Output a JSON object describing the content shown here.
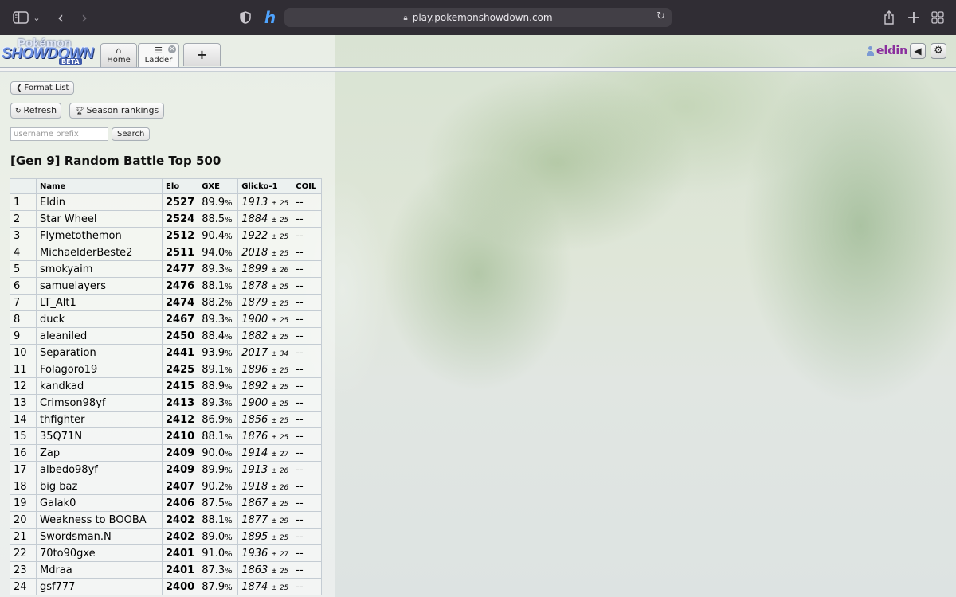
{
  "browser": {
    "url": "play.pokemonshowdown.com"
  },
  "logo": {
    "top": "Pokémon",
    "main": "SHOWDOWN",
    "sub": "BETA"
  },
  "nav": {
    "home_label": "Home",
    "ladder_label": "Ladder",
    "new_tab_label": "+"
  },
  "user": {
    "name": "eldin"
  },
  "page": {
    "format_list_label": "Format List",
    "refresh_label": "Refresh",
    "season_rankings_label": "Season rankings",
    "search_placeholder": "username prefix",
    "search_label": "Search",
    "title": "[Gen 9] Random Battle Top 500"
  },
  "table": {
    "headers": [
      "",
      "Name",
      "Elo",
      "GXE",
      "Glicko-1",
      "COIL"
    ],
    "rows": [
      {
        "rank": "1",
        "name": "Eldin",
        "elo": "2527",
        "gxe": "89.9",
        "glicko": "1913",
        "dev": "± 25",
        "coil": "--"
      },
      {
        "rank": "2",
        "name": "Star Wheel",
        "elo": "2524",
        "gxe": "88.5",
        "glicko": "1884",
        "dev": "± 25",
        "coil": "--"
      },
      {
        "rank": "3",
        "name": "Flymetothemon",
        "elo": "2512",
        "gxe": "90.4",
        "glicko": "1922",
        "dev": "± 25",
        "coil": "--"
      },
      {
        "rank": "4",
        "name": "MichaelderBeste2",
        "elo": "2511",
        "gxe": "94.0",
        "glicko": "2018",
        "dev": "± 25",
        "coil": "--"
      },
      {
        "rank": "5",
        "name": "smokyaim",
        "elo": "2477",
        "gxe": "89.3",
        "glicko": "1899",
        "dev": "± 26",
        "coil": "--"
      },
      {
        "rank": "6",
        "name": "samuelayers",
        "elo": "2476",
        "gxe": "88.1",
        "glicko": "1878",
        "dev": "± 25",
        "coil": "--"
      },
      {
        "rank": "7",
        "name": "LT_Alt1",
        "elo": "2474",
        "gxe": "88.2",
        "glicko": "1879",
        "dev": "± 25",
        "coil": "--"
      },
      {
        "rank": "8",
        "name": "duck",
        "elo": "2467",
        "gxe": "89.3",
        "glicko": "1900",
        "dev": "± 25",
        "coil": "--"
      },
      {
        "rank": "9",
        "name": "aleaniled",
        "elo": "2450",
        "gxe": "88.4",
        "glicko": "1882",
        "dev": "± 25",
        "coil": "--"
      },
      {
        "rank": "10",
        "name": "Separation",
        "elo": "2441",
        "gxe": "93.9",
        "glicko": "2017",
        "dev": "± 34",
        "coil": "--"
      },
      {
        "rank": "11",
        "name": "Folagoro19",
        "elo": "2425",
        "gxe": "89.1",
        "glicko": "1896",
        "dev": "± 25",
        "coil": "--"
      },
      {
        "rank": "12",
        "name": "kandkad",
        "elo": "2415",
        "gxe": "88.9",
        "glicko": "1892",
        "dev": "± 25",
        "coil": "--"
      },
      {
        "rank": "13",
        "name": "Crimson98yf",
        "elo": "2413",
        "gxe": "89.3",
        "glicko": "1900",
        "dev": "± 25",
        "coil": "--"
      },
      {
        "rank": "14",
        "name": "thfighter",
        "elo": "2412",
        "gxe": "86.9",
        "glicko": "1856",
        "dev": "± 25",
        "coil": "--"
      },
      {
        "rank": "15",
        "name": "35Q71N",
        "elo": "2410",
        "gxe": "88.1",
        "glicko": "1876",
        "dev": "± 25",
        "coil": "--"
      },
      {
        "rank": "16",
        "name": "Zap",
        "elo": "2409",
        "gxe": "90.0",
        "glicko": "1914",
        "dev": "± 27",
        "coil": "--"
      },
      {
        "rank": "17",
        "name": "albedo98yf",
        "elo": "2409",
        "gxe": "89.9",
        "glicko": "1913",
        "dev": "± 26",
        "coil": "--"
      },
      {
        "rank": "18",
        "name": "big baz",
        "elo": "2407",
        "gxe": "90.2",
        "glicko": "1918",
        "dev": "± 26",
        "coil": "--"
      },
      {
        "rank": "19",
        "name": "Galak0",
        "elo": "2406",
        "gxe": "87.5",
        "glicko": "1867",
        "dev": "± 25",
        "coil": "--"
      },
      {
        "rank": "20",
        "name": "Weakness to BOOBA",
        "elo": "2402",
        "gxe": "88.1",
        "glicko": "1877",
        "dev": "± 29",
        "coil": "--"
      },
      {
        "rank": "21",
        "name": "Swordsman.N",
        "elo": "2402",
        "gxe": "89.0",
        "glicko": "1895",
        "dev": "± 25",
        "coil": "--"
      },
      {
        "rank": "22",
        "name": "70to90gxe",
        "elo": "2401",
        "gxe": "91.0",
        "glicko": "1936",
        "dev": "± 27",
        "coil": "--"
      },
      {
        "rank": "23",
        "name": "Mdraa",
        "elo": "2401",
        "gxe": "87.3",
        "glicko": "1863",
        "dev": "± 25",
        "coil": "--"
      },
      {
        "rank": "24",
        "name": "gsf777",
        "elo": "2400",
        "gxe": "87.9",
        "glicko": "1874",
        "dev": "± 25",
        "coil": "--"
      }
    ]
  }
}
